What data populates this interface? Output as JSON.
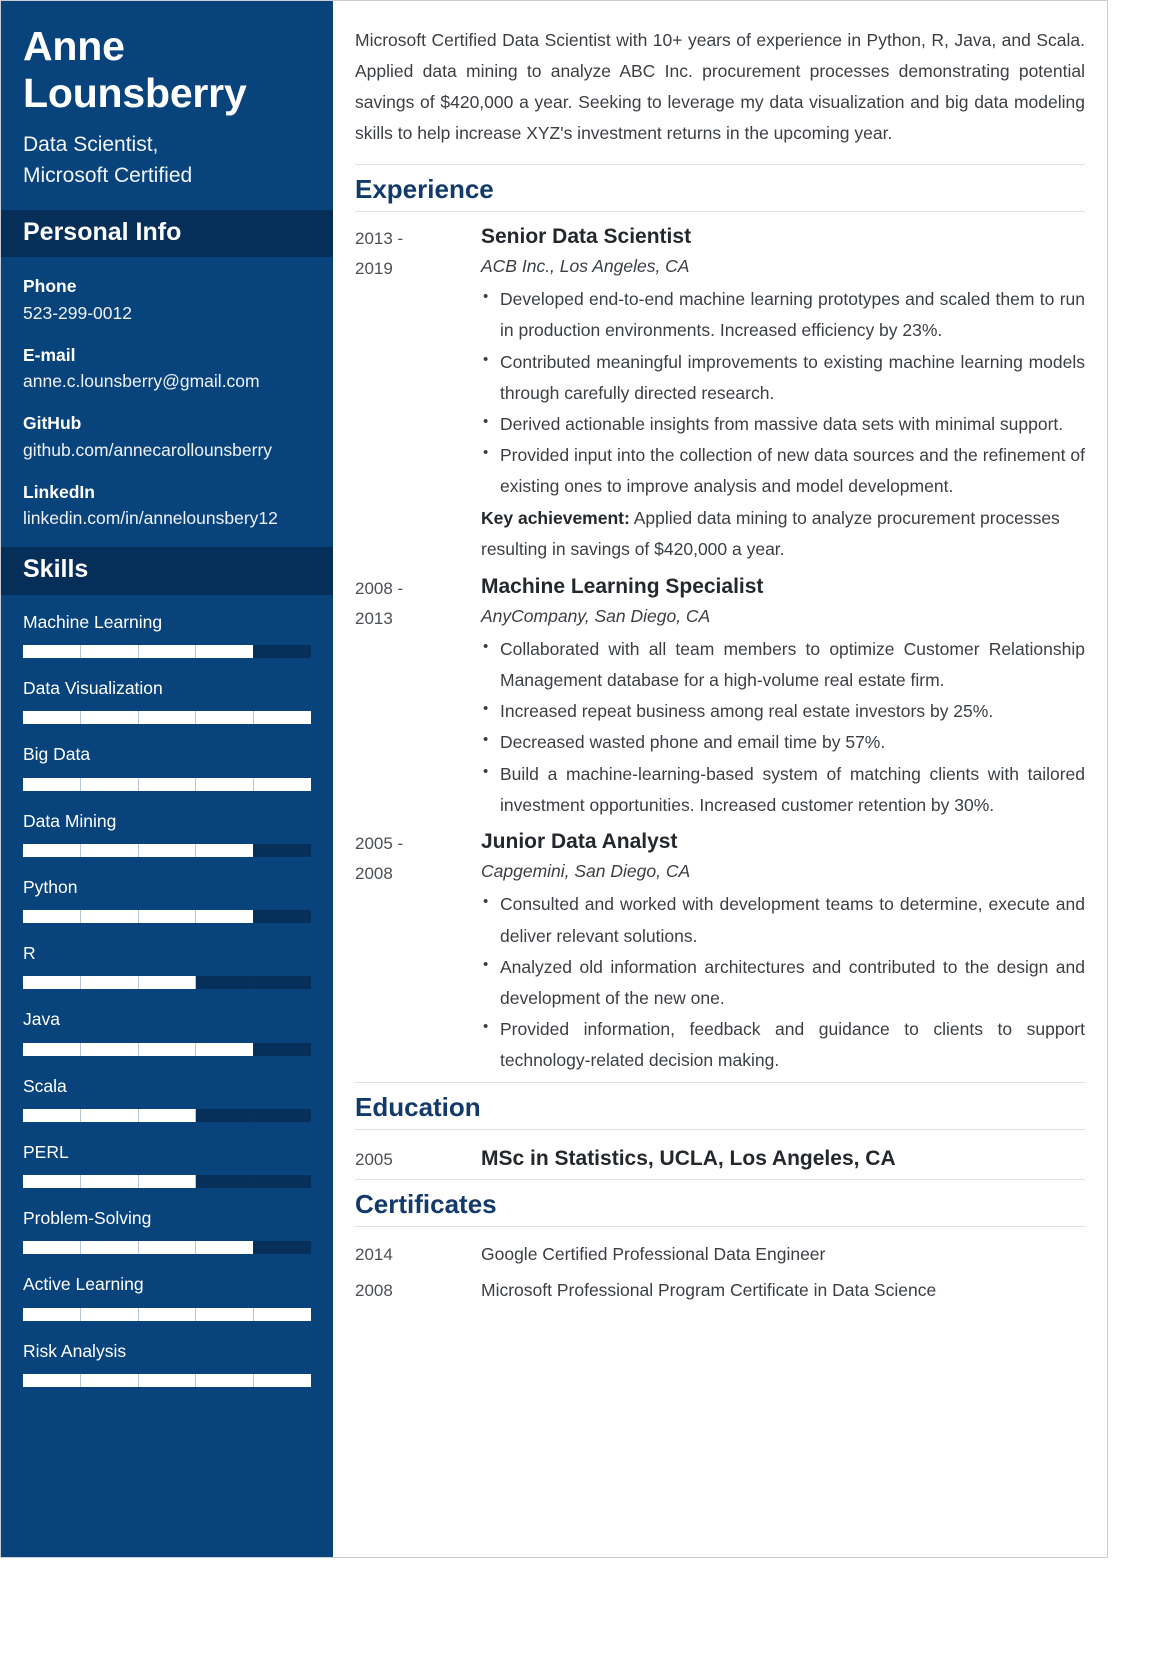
{
  "sidebar": {
    "name": "Anne Lounsberry",
    "role_line1": "Data Scientist,",
    "role_line2": "Microsoft Certified",
    "personal_info_heading": "Personal Info",
    "skills_heading": "Skills",
    "contacts": [
      {
        "label": "Phone",
        "value": "523-299-0012"
      },
      {
        "label": "E-mail",
        "value": "anne.c.lounsberry@gmail.com"
      },
      {
        "label": "GitHub",
        "value": "github.com/annecarollounsberry"
      },
      {
        "label": "LinkedIn",
        "value": "linkedin.com/in/annelounsbery12"
      }
    ],
    "skills": [
      {
        "label": "Machine Learning",
        "level": 80
      },
      {
        "label": "Data Visualization",
        "level": 100
      },
      {
        "label": "Big Data",
        "level": 100
      },
      {
        "label": "Data Mining",
        "level": 80
      },
      {
        "label": "Python",
        "level": 80
      },
      {
        "label": "R",
        "level": 60
      },
      {
        "label": "Java",
        "level": 80
      },
      {
        "label": "Scala",
        "level": 60
      },
      {
        "label": "PERL",
        "level": 60
      },
      {
        "label": "Problem-Solving",
        "level": 80
      },
      {
        "label": "Active Learning",
        "level": 100
      },
      {
        "label": "Risk Analysis",
        "level": 100
      }
    ]
  },
  "main": {
    "summary": "Microsoft Certified Data Scientist with 10+ years of experience in Python, R, Java, and Scala. Applied data mining to analyze ABC Inc. procurement processes demonstrating potential savings of $420,000 a year. Seeking to leverage my data visualization and big data modeling skills to help increase XYZ's investment returns in the upcoming year.",
    "experience_heading": "Experience",
    "education_heading": "Education",
    "certificates_heading": "Certificates",
    "experience": [
      {
        "date_start": "2013 -",
        "date_end": "2019",
        "title": "Senior Data Scientist",
        "company": "ACB Inc., Los Angeles, CA",
        "bullets": [
          "Developed end-to-end machine learning prototypes and scaled them to run in production environments. Increased efficiency by 23%.",
          "Contributed meaningful improvements to existing machine learning models through carefully directed research.",
          "Derived actionable insights from massive data sets with minimal support.",
          "Provided input into the collection of new data sources and the refinement of existing ones to improve analysis and model development."
        ],
        "key_achievement_label": "Key achievement:",
        "key_achievement_text": " Applied data mining to analyze procurement processes resulting in savings of $420,000 a year."
      },
      {
        "date_start": "2008 -",
        "date_end": "2013",
        "title": "Machine Learning Specialist",
        "company": "AnyCompany,  San Diego, CA",
        "bullets": [
          "Collaborated with all team members to optimize Customer Relationship Management database for a high-volume real estate firm.",
          "Increased repeat business among real estate investors by 25%.",
          "Decreased wasted phone and email time by 57%.",
          "Build a machine-learning-based system of matching clients with tailored investment opportunities. Increased customer retention by 30%."
        ],
        "key_achievement_label": "",
        "key_achievement_text": ""
      },
      {
        "date_start": "2005 -",
        "date_end": "2008",
        "title": "Junior Data Analyst",
        "company": "Capgemini, San Diego, CA",
        "bullets": [
          "Consulted and worked with development teams to determine, execute and deliver relevant solutions.",
          "Analyzed old information architectures and contributed to the design and development of the new one.",
          "Provided information, feedback and guidance to clients to support technology-related decision making."
        ],
        "key_achievement_label": "",
        "key_achievement_text": ""
      }
    ],
    "education": [
      {
        "date": "2005",
        "title": "MSc in Statistics, UCLA, Los Angeles, CA"
      }
    ],
    "certificates": [
      {
        "date": "2014",
        "text": "Google Certified Professional Data Engineer"
      },
      {
        "date": "2008",
        "text": "Microsoft Professional Program Certificate in Data Science"
      }
    ]
  },
  "colors": {
    "sidebar_bg": "#08437c",
    "sidebar_heading_bg": "#052f59",
    "accent_heading": "#123a6b",
    "body_text": "#3b3f44"
  }
}
